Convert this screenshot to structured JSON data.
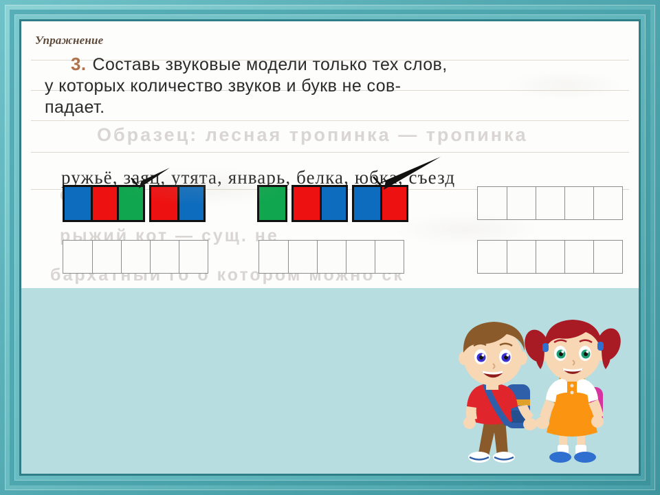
{
  "slide": {
    "frame_color": "#4fa8b0",
    "background_color": "#b8dde0",
    "page_color": "#fdfdfb"
  },
  "page": {
    "exercise_label": "Упражнение",
    "task": {
      "number": "3.",
      "line1": "Составь звуковые модели только тех слов,",
      "line2": "у которых количество звуков и букв не сов-",
      "line3": "падает."
    },
    "words_line": "ружьё, заяц, утята, январь, белка, юбка, съезд",
    "ghost_text": {
      "line1": "Образец:   лесная   тропинка   —   тропинка",
      "line2": "ф                                  ат",
      "line3": "рыжий   кот   —   сущ. не",
      "line4": "бархатный   го             о   котором   можно   ск"
    }
  },
  "sound_models": {
    "colors": {
      "blue": "#0d6cbd",
      "red": "#ee1111",
      "green": "#10a64f",
      "outline": "#111111"
    },
    "model_1": {
      "label": "sound-model-ruzhyo",
      "groups": [
        {
          "cells": [
            "blue",
            "red",
            "green"
          ]
        },
        {
          "cells": [
            "red",
            "blue"
          ]
        }
      ]
    },
    "model_2": {
      "label": "sound-model-yubka",
      "groups": [
        {
          "cells": [
            "green"
          ]
        },
        {
          "cells": [
            "red",
            "blue"
          ]
        },
        {
          "cells": [
            "blue",
            "red"
          ]
        }
      ]
    }
  },
  "empty_grids": [
    {
      "name": "empty-grid-top-right",
      "cells": 5
    },
    {
      "name": "empty-grid-bottom-left",
      "cells": 5
    },
    {
      "name": "empty-grid-bottom-middle",
      "cells": 5
    },
    {
      "name": "empty-grid-bottom-right",
      "cells": 5
    }
  ],
  "annotations": {
    "arrow_1_name": "pointer-arrow-to-green-cell",
    "arrow_2_name": "pointer-arrow-to-red-cell"
  },
  "illustration": {
    "name": "two-schoolchildren",
    "boy": {
      "hair": "#8a5a2b",
      "skin": "#f7d7b4",
      "shirt": "#e0262c",
      "pants": "#8a5a2b",
      "backpack": "#2f5fa8",
      "shoes": "#ffffff"
    },
    "girl": {
      "hair": "#a81a24",
      "skin": "#f7d7b4",
      "blouse": "#ffffff",
      "dress": "#fb9410",
      "backpack": "#d633a0",
      "shoes": "#2f6fd0"
    }
  }
}
